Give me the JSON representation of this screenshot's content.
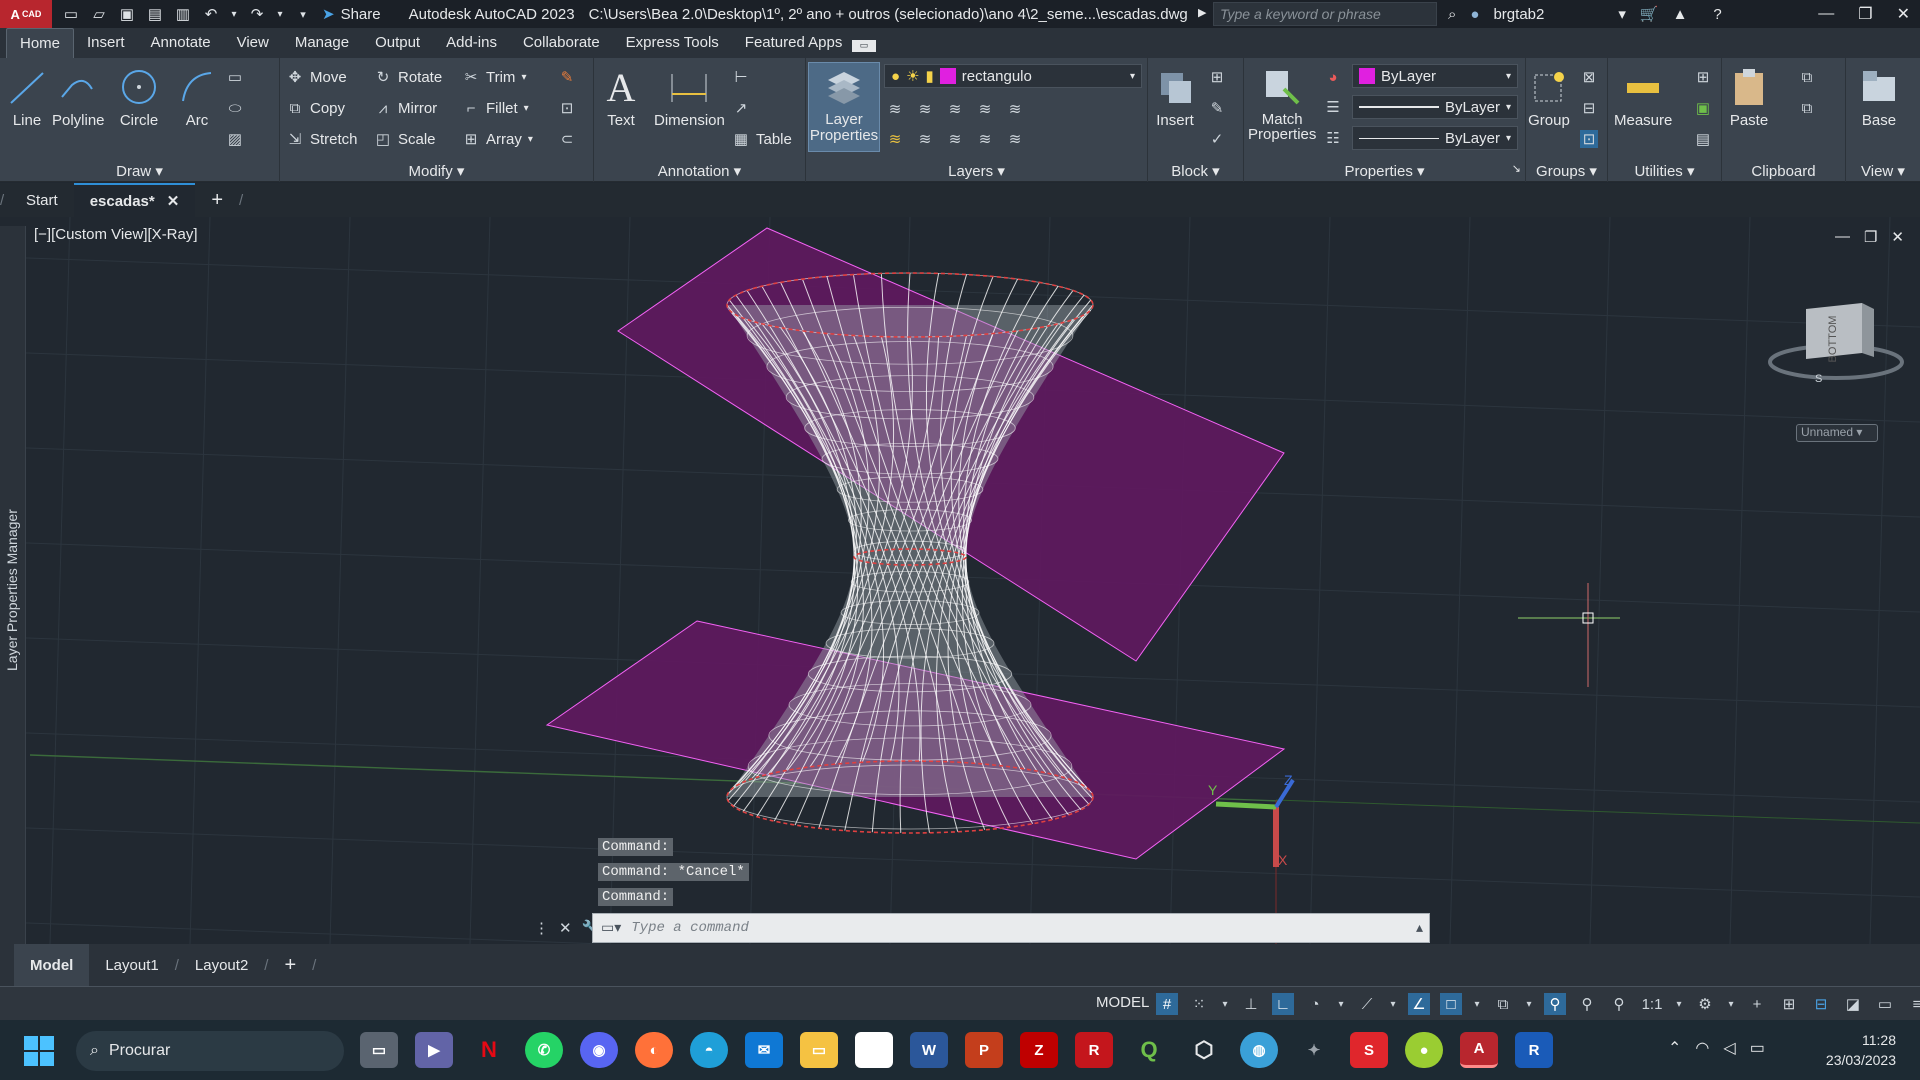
{
  "app": {
    "logo_text": "A",
    "logo_sub": "CAD",
    "title": "Autodesk AutoCAD 2023",
    "file_path": "C:\\Users\\Bea 2.0\\Desktop\\1º, 2º ano + outros (selecionado)\\ano 4\\2_seme...\\escadas.dwg",
    "share_label": "Share",
    "search_placeholder": "Type a keyword or phrase",
    "user": "brgtab2"
  },
  "menu_tabs": [
    "Home",
    "Insert",
    "Annotate",
    "View",
    "Manage",
    "Output",
    "Add-ins",
    "Collaborate",
    "Express Tools",
    "Featured Apps"
  ],
  "ribbon": {
    "draw": {
      "title": "Draw",
      "line": "Line",
      "polyline": "Polyline",
      "circle": "Circle",
      "arc": "Arc"
    },
    "modify": {
      "title": "Modify",
      "move": "Move",
      "rotate": "Rotate",
      "trim": "Trim",
      "copy": "Copy",
      "mirror": "Mirror",
      "fillet": "Fillet",
      "stretch": "Stretch",
      "scale": "Scale",
      "array": "Array"
    },
    "annotation": {
      "title": "Annotation",
      "text": "Text",
      "dimension": "Dimension",
      "table": "Table"
    },
    "layers": {
      "title": "Layers",
      "layer_properties_1": "Layer",
      "layer_properties_2": "Properties",
      "current_layer": "rectangulo",
      "layer_color": "#e020e0"
    },
    "block": {
      "title": "Block",
      "insert": "Insert"
    },
    "properties": {
      "title": "Properties",
      "match_1": "Match",
      "match_2": "Properties",
      "color": "ByLayer",
      "linetype": "ByLayer",
      "lineweight": "ByLayer",
      "color_swatch": "#e020e0"
    },
    "groups": {
      "title": "Groups",
      "group": "Group"
    },
    "utilities": {
      "title": "Utilities",
      "measure": "Measure"
    },
    "clipboard": {
      "title": "Clipboard",
      "paste": "Paste"
    },
    "view": {
      "title": "View",
      "base": "Base"
    }
  },
  "doc_tabs": {
    "start": "Start",
    "active": "escadas*"
  },
  "viewport": {
    "label": "[−][Custom View][X-Ray]",
    "side_palette": "Layer Properties Manager",
    "viewcube_face": "BOTTOM",
    "viewcube_s": "S",
    "ucs_name": "Unnamed",
    "ucs_z": "Z",
    "ucs_y": "Y",
    "ucs_x": "X",
    "plane_color": "#5e1a5e",
    "wire_color": "#ffffff",
    "edge_color": "#e04040"
  },
  "command": {
    "history": [
      "Command:",
      "Command: *Cancel*",
      "Command:"
    ],
    "placeholder": "Type a command"
  },
  "layout_tabs": [
    "Model",
    "Layout1",
    "Layout2"
  ],
  "status": {
    "model": "MODEL",
    "scale": "1:1"
  },
  "taskbar": {
    "search": "Procurar",
    "time": "11:28",
    "date": "23/03/2023"
  }
}
